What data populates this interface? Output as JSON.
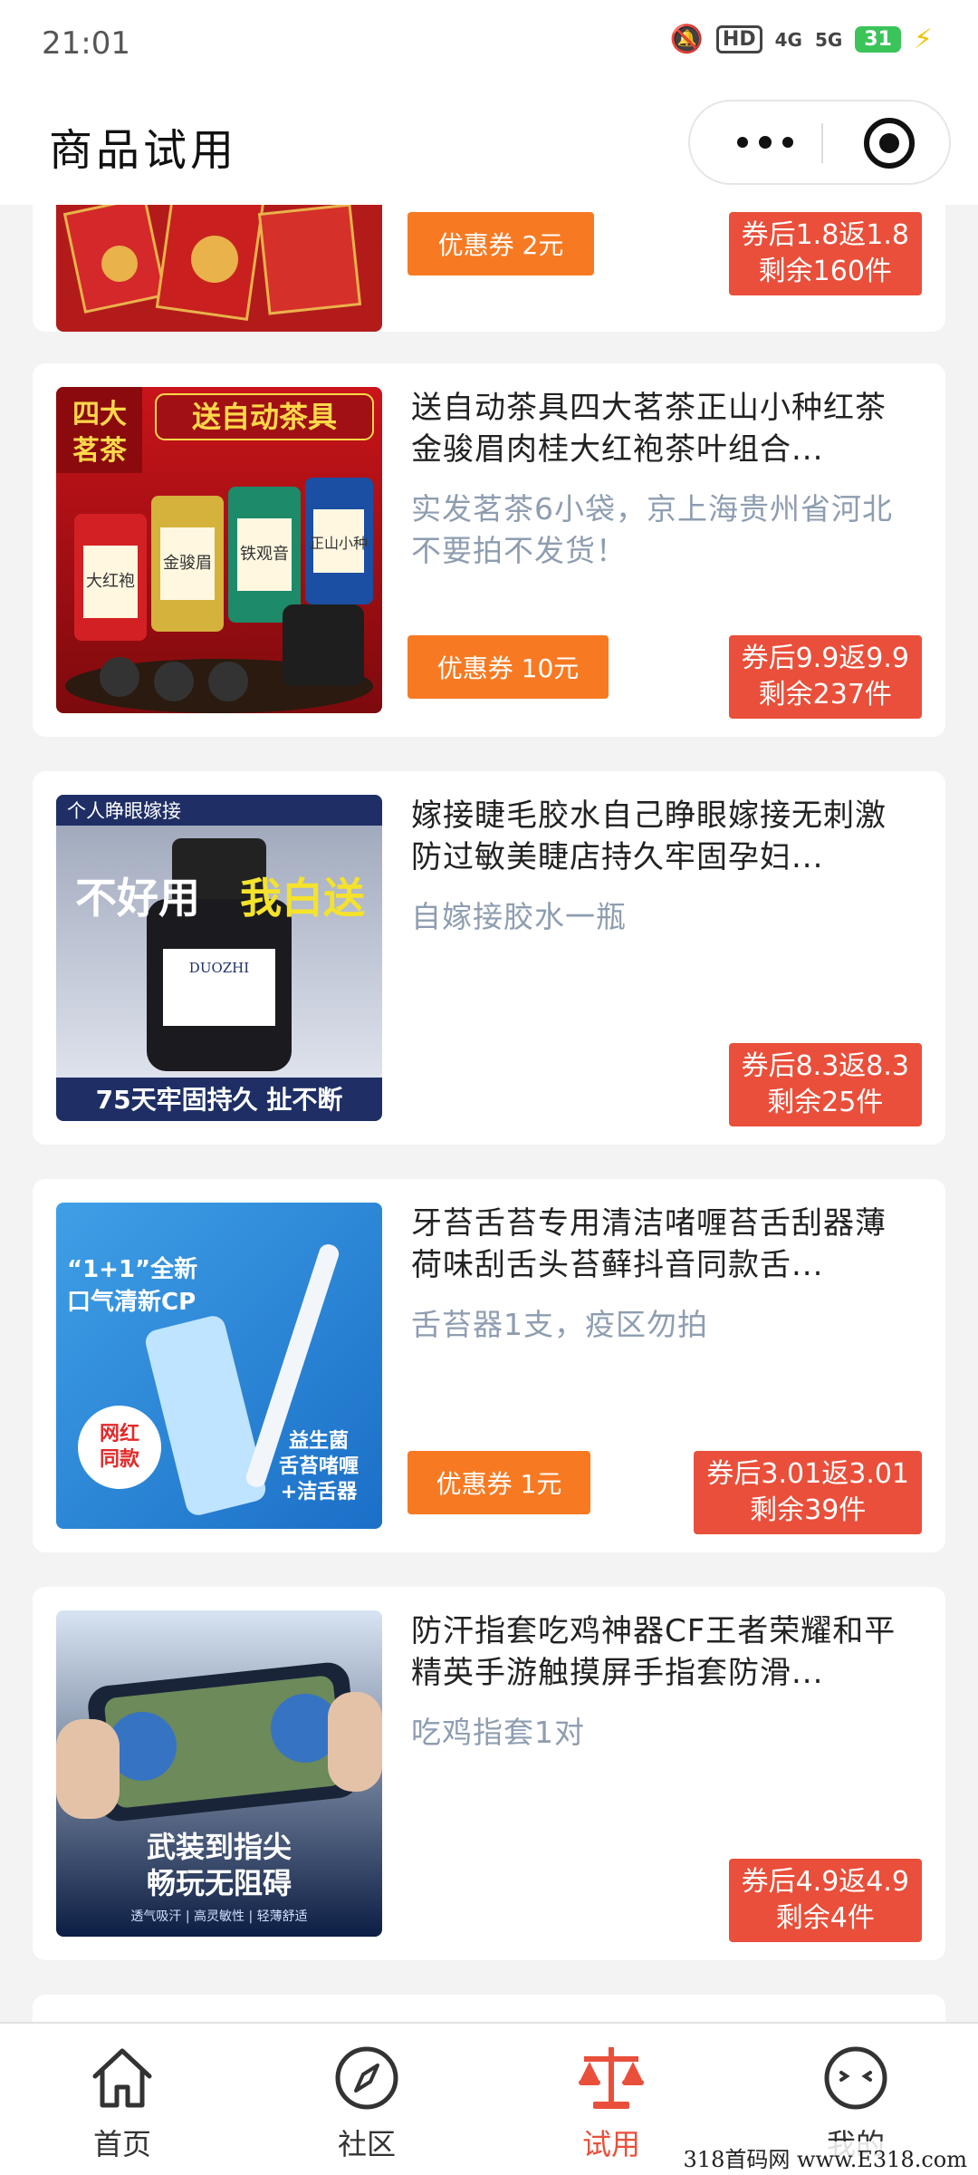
{
  "status": {
    "time": "21:01",
    "hd": "HD",
    "net1": "4G",
    "net2": "5G",
    "battery": "31"
  },
  "header": {
    "title": "商品试用"
  },
  "items": [
    {
      "title": "",
      "desc": "",
      "coupon": "优惠券 2元",
      "price_line1": "券后1.8返1.8",
      "price_line2": "剩余160件"
    },
    {
      "title": "送自动茶具四大茗茶正山小种红茶金骏眉肉桂大红袍茶叶组合...",
      "desc": "实发茗茶6小袋，京上海贵州省河北不要拍不发货！",
      "coupon": "优惠券 10元",
      "price_line1": "券后9.9返9.9",
      "price_line2": "剩余237件",
      "img_text": {
        "badge1": "四大",
        "badge2": "茗茶",
        "banner": "送自动茶具",
        "can1": "大红袍",
        "can2": "金骏眉",
        "can3": "铁观音",
        "can4": "正山小种"
      }
    },
    {
      "title": "嫁接睫毛胶水自己睁眼嫁接无刺激防过敏美睫店持久牢固孕妇...",
      "desc": "自嫁接胶水一瓶",
      "coupon": "",
      "price_line1": "券后8.3返8.3",
      "price_line2": "剩余25件",
      "img_text": {
        "top": "个人睁眼嫁接",
        "main1": "不好用",
        "main2": "我白送",
        "brand": "DUOZHI",
        "bottom": "75天牢固持久 扯不断"
      }
    },
    {
      "title": "牙苔舌苔专用清洁啫喱苔舌刮器薄荷味刮舌头苔藓抖音同款舌...",
      "desc": "舌苔器1支，疫区勿拍",
      "coupon": "优惠券 1元",
      "price_line1": "券后3.01返3.01",
      "price_line2": "剩余39件",
      "img_text": {
        "t1": "“1+1”全新",
        "t2": "口气清新CP",
        "badge1": "网红",
        "badge2": "同款",
        "r1": "益生菌",
        "r2": "舌苔啫喱",
        "r3": "+洁舌器"
      }
    },
    {
      "title": "防汗指套吃鸡神器CF王者荣耀和平精英手游触摸屏手指套防滑...",
      "desc": "吃鸡指套1对",
      "coupon": "",
      "price_line1": "券后4.9返4.9",
      "price_line2": "剩余4件",
      "img_text": {
        "l1": "武装到指尖",
        "l2": "畅玩无阻碍",
        "l3": "透气吸汗 | 高灵敏性 | 轻薄舒适"
      }
    }
  ],
  "tabs": [
    {
      "label": "首页",
      "icon": "home-icon"
    },
    {
      "label": "社区",
      "icon": "compass-icon"
    },
    {
      "label": "试用",
      "icon": "scale-icon"
    },
    {
      "label": "我的",
      "icon": "face-icon"
    }
  ],
  "colors": {
    "accent": "#e94f3a",
    "coupon": "#f77a23",
    "desc": "#8e9db0"
  },
  "watermark": "318首码网 www.E318.com"
}
